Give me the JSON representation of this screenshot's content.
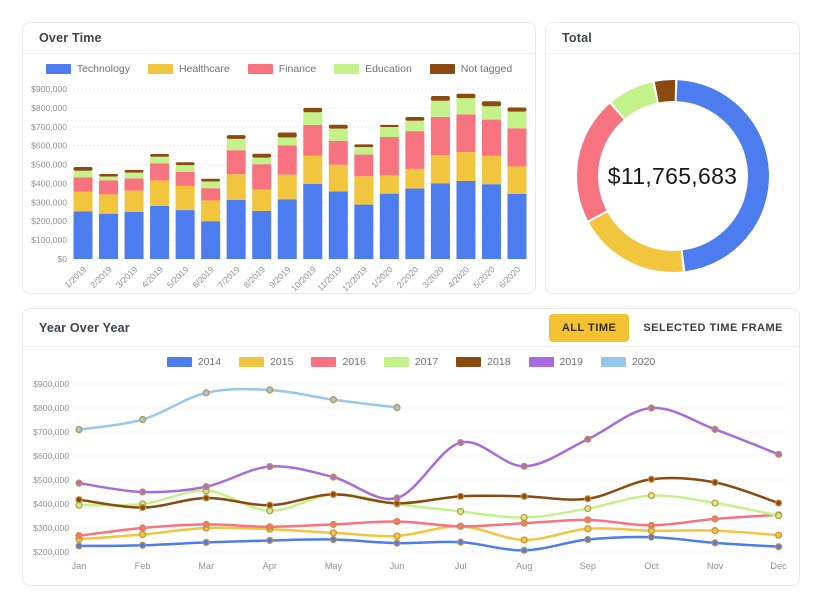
{
  "palette": {
    "technology_blue": "#4d7cee",
    "healthcare_yellow": "#f2c53e",
    "finance_pink": "#f7737f",
    "education_green": "#c3f28b",
    "not_tagged_brown": "#8b4a10",
    "year_2019_purple": "#a76be0",
    "year_2020_lightblue": "#95c8ea",
    "accent_button": "#f2c233",
    "grid": "#e4e6ea",
    "point_ring": "#c8913a"
  },
  "cards": {
    "over_time": {
      "title": "Over Time"
    },
    "total": {
      "title": "Total",
      "center_text": "$11,765,683"
    },
    "year_over_year": {
      "title": "Year Over Year",
      "buttons": [
        {
          "label": "ALL TIME",
          "active": true
        },
        {
          "label": "SELECTED TIME FRAME",
          "active": false
        }
      ]
    }
  },
  "chart_data": [
    {
      "type": "bar",
      "stacked": true,
      "card": "Over Time",
      "categories": [
        "1/2019",
        "2/2019",
        "3/2019",
        "4/2019",
        "5/2019",
        "6/2019",
        "7/2019",
        "8/2019",
        "9/2019",
        "10/2019",
        "11/2019",
        "12/2019",
        "1/2020",
        "2/2020",
        "3/2020",
        "4/2020",
        "5/2020",
        "6/2020"
      ],
      "series": [
        {
          "name": "Technology",
          "color": "#4d7cee",
          "values": [
            252000,
            240000,
            249000,
            281000,
            259000,
            200000,
            313000,
            255000,
            316000,
            398000,
            358000,
            288000,
            346000,
            373000,
            400000,
            413000,
            396000,
            345000
          ]
        },
        {
          "name": "Healthcare",
          "color": "#f2c53e",
          "values": [
            105000,
            102000,
            113000,
            135000,
            128000,
            110000,
            136000,
            112000,
            130000,
            149000,
            141000,
            150000,
            97000,
            104000,
            150000,
            153000,
            150000,
            145000
          ]
        },
        {
          "name": "Finance",
          "color": "#f7737f",
          "values": [
            75000,
            75000,
            65000,
            90000,
            75000,
            65000,
            127000,
            135000,
            155000,
            163000,
            127000,
            115000,
            203000,
            200000,
            203000,
            200000,
            192000,
            202000
          ]
        },
        {
          "name": "Education",
          "color": "#c3f28b",
          "values": [
            35000,
            20000,
            30000,
            35000,
            35000,
            35000,
            60000,
            35000,
            42000,
            67000,
            64000,
            39000,
            53000,
            55000,
            85000,
            86000,
            71000,
            88000
          ]
        },
        {
          "name": "Not tagged",
          "color": "#8b4a10",
          "values": [
            20000,
            13000,
            15000,
            15000,
            15000,
            15000,
            20000,
            20000,
            27000,
            23000,
            21000,
            15000,
            11000,
            20000,
            25000,
            23000,
            26000,
            22000
          ]
        }
      ],
      "ylim": [
        0,
        900000
      ],
      "ytick_step": 100000,
      "yticks": [
        "$0",
        "$100,000",
        "$200,000",
        "$300,000",
        "$400,000",
        "$500,000",
        "$600,000",
        "$700,000",
        "$800,000",
        "$900,000"
      ],
      "grid": "dotted",
      "legend_position": "top"
    },
    {
      "type": "pie",
      "variant": "donut",
      "card": "Total",
      "center_text": "$11,765,683",
      "start_angle_deg": 2,
      "slices": [
        {
          "label": "Technology",
          "color": "#4d7cee",
          "percent": 47.6
        },
        {
          "label": "Healthcare",
          "color": "#f2c53e",
          "percent": 19.0
        },
        {
          "label": "Finance",
          "color": "#f7737f",
          "percent": 21.6
        },
        {
          "label": "Education",
          "color": "#c3f28b",
          "percent": 8.0
        },
        {
          "label": "Not tagged",
          "color": "#8b4a10",
          "percent": 3.8
        }
      ]
    },
    {
      "type": "line",
      "card": "Year Over Year",
      "x": [
        "Jan",
        "Feb",
        "Mar",
        "Apr",
        "May",
        "Jun",
        "Jul",
        "Aug",
        "Sep",
        "Oct",
        "Nov",
        "Dec"
      ],
      "series": [
        {
          "name": "2014",
          "color": "#4d7cee",
          "values": [
            225000,
            228000,
            240000,
            248000,
            252000,
            237000,
            241000,
            207000,
            252000,
            262000,
            238000,
            222000
          ]
        },
        {
          "name": "2015",
          "color": "#f2c53e",
          "values": [
            253000,
            273000,
            300000,
            295000,
            280000,
            267000,
            307000,
            250000,
            297000,
            289000,
            289000,
            270000
          ]
        },
        {
          "name": "2016",
          "color": "#f7737f",
          "values": [
            268000,
            300000,
            315000,
            305000,
            315000,
            327000,
            307000,
            320000,
            334000,
            311000,
            338000,
            355000
          ]
        },
        {
          "name": "2017",
          "color": "#c3f28b",
          "values": [
            395000,
            400000,
            455000,
            372000,
            440000,
            400000,
            369000,
            344000,
            381000,
            435000,
            404000,
            352000
          ]
        },
        {
          "name": "2018",
          "color": "#8b4a10",
          "values": [
            418000,
            385000,
            425000,
            395000,
            440000,
            403000,
            432000,
            432000,
            422000,
            503000,
            490000,
            404000
          ]
        },
        {
          "name": "2019",
          "color": "#a76be0",
          "values": [
            487000,
            450000,
            472000,
            556000,
            512000,
            425000,
            656000,
            557000,
            670000,
            800000,
            711000,
            607000
          ]
        },
        {
          "name": "2020",
          "color": "#95c8ea",
          "values": [
            710000,
            752000,
            863000,
            875000,
            835000,
            802000,
            null,
            null,
            null,
            null,
            null,
            null
          ]
        }
      ],
      "ylim": [
        200000,
        900000
      ],
      "ytick_step": 100000,
      "yticks": [
        "$200,000",
        "$300,000",
        "$400,000",
        "$500,000",
        "$600,000",
        "$700,000",
        "$800,000",
        "$900,000"
      ],
      "grid": "dotted",
      "legend_position": "top"
    }
  ]
}
